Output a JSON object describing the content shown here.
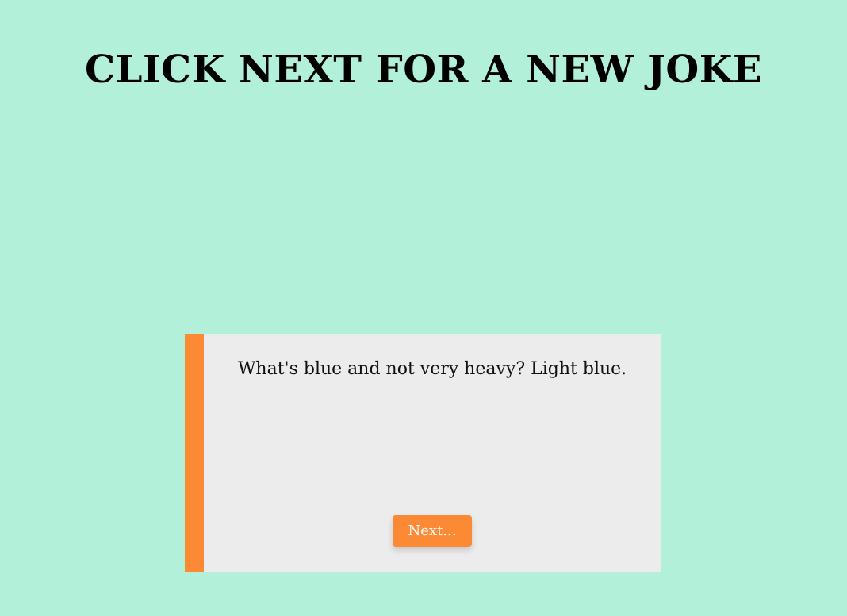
{
  "page": {
    "title": "CLICK NEXT FOR A NEW JOKE",
    "background_color": "#b2f0da"
  },
  "joke_card": {
    "joke_text": "What's blue and not very heavy? Light blue.",
    "accent_color": "#fc8934",
    "background_color": "#ececec",
    "next_button_label": "Next..."
  }
}
